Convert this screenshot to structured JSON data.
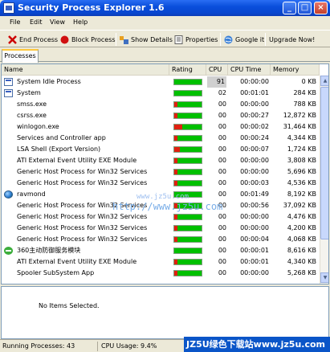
{
  "window": {
    "title": "Security Process Explorer 1.6"
  },
  "menu": [
    "File",
    "Edit",
    "View",
    "Help"
  ],
  "toolbar": {
    "end_process": "End Process",
    "block_process": "Block Process",
    "show_details": "Show Details",
    "properties": "Properties",
    "google_it": "Google it",
    "upgrade": "Upgrade Now!"
  },
  "tab": "Processes",
  "columns": {
    "name": "Name",
    "rating": "Rating",
    "cpu": "CPU",
    "cpu_time": "CPU Time",
    "memory": "Memory"
  },
  "processes": [
    {
      "name": "System Idle Process",
      "rating": 0,
      "cpu": "91",
      "time": "00:00:00",
      "mem": "0 KB",
      "icon": "window-icon"
    },
    {
      "name": "System",
      "rating": 0,
      "cpu": "02",
      "time": "00:01:01",
      "mem": "284 KB",
      "icon": "window-icon"
    },
    {
      "name": "smss.exe",
      "rating": 0.12,
      "cpu": "00",
      "time": "00:00:00",
      "mem": "788 KB",
      "icon": ""
    },
    {
      "name": "csrss.exe",
      "rating": 0.12,
      "cpu": "00",
      "time": "00:00:27",
      "mem": "12,872 KB",
      "icon": ""
    },
    {
      "name": "winlogon.exe",
      "rating": 0.3,
      "cpu": "00",
      "time": "00:00:02",
      "mem": "31,464 KB",
      "icon": ""
    },
    {
      "name": "Services and Controller app",
      "rating": 0.12,
      "cpu": "00",
      "time": "00:00:24",
      "mem": "4,344 KB",
      "icon": ""
    },
    {
      "name": "LSA Shell (Export Version)",
      "rating": 0.2,
      "cpu": "00",
      "time": "00:00:07",
      "mem": "1,724 KB",
      "icon": ""
    },
    {
      "name": "ATI External Event Utility EXE Module",
      "rating": 0.12,
      "cpu": "00",
      "time": "00:00:00",
      "mem": "3,808 KB",
      "icon": ""
    },
    {
      "name": "Generic Host Process for Win32 Services",
      "rating": 0.12,
      "cpu": "00",
      "time": "00:00:00",
      "mem": "5,696 KB",
      "icon": ""
    },
    {
      "name": "Generic Host Process for Win32 Services",
      "rating": 0.12,
      "cpu": "00",
      "time": "00:00:03",
      "mem": "4,536 KB",
      "icon": ""
    },
    {
      "name": "ravmond",
      "rating": 0,
      "cpu": "00",
      "time": "00:01:49",
      "mem": "8,192 KB",
      "icon": "globe-icon"
    },
    {
      "name": "Generic Host Process for Win32 Services",
      "rating": 0.12,
      "cpu": "00",
      "time": "00:00:56",
      "mem": "37,092 KB",
      "icon": ""
    },
    {
      "name": "Generic Host Process for Win32 Services",
      "rating": 0.12,
      "cpu": "00",
      "time": "00:00:00",
      "mem": "4,476 KB",
      "icon": ""
    },
    {
      "name": "Generic Host Process for Win32 Services",
      "rating": 0.12,
      "cpu": "00",
      "time": "00:00:00",
      "mem": "4,200 KB",
      "icon": ""
    },
    {
      "name": "Generic Host Process for Win32 Services",
      "rating": 0.12,
      "cpu": "00",
      "time": "00:00:04",
      "mem": "4,068 KB",
      "icon": ""
    },
    {
      "name": "360主动防御服务模块",
      "rating": 0,
      "cpu": "00",
      "time": "00:00:01",
      "mem": "8,616 KB",
      "icon": "plus-icon"
    },
    {
      "name": "ATI External Event Utility EXE Module",
      "rating": 0.12,
      "cpu": "00",
      "time": "00:00:01",
      "mem": "4,340 KB",
      "icon": ""
    },
    {
      "name": "Spooler SubSystem App",
      "rating": 0.12,
      "cpu": "00",
      "time": "00:00:00",
      "mem": "5,268 KB",
      "icon": ""
    }
  ],
  "watermark": {
    "line1": "www.jz5u.com",
    "line2": "http://www.jz5u.com"
  },
  "details": {
    "empty_text": "No Items Selected."
  },
  "status": {
    "running": "Running Processes: 43",
    "cpu_usage": "CPU Usage: 9.4%",
    "brand": "JZ5U绿色下载站www.jz5u.com"
  },
  "colors": {
    "title_blue": "#0a4fdc",
    "rating_green": "#00c000",
    "rating_red": "#e02010"
  }
}
